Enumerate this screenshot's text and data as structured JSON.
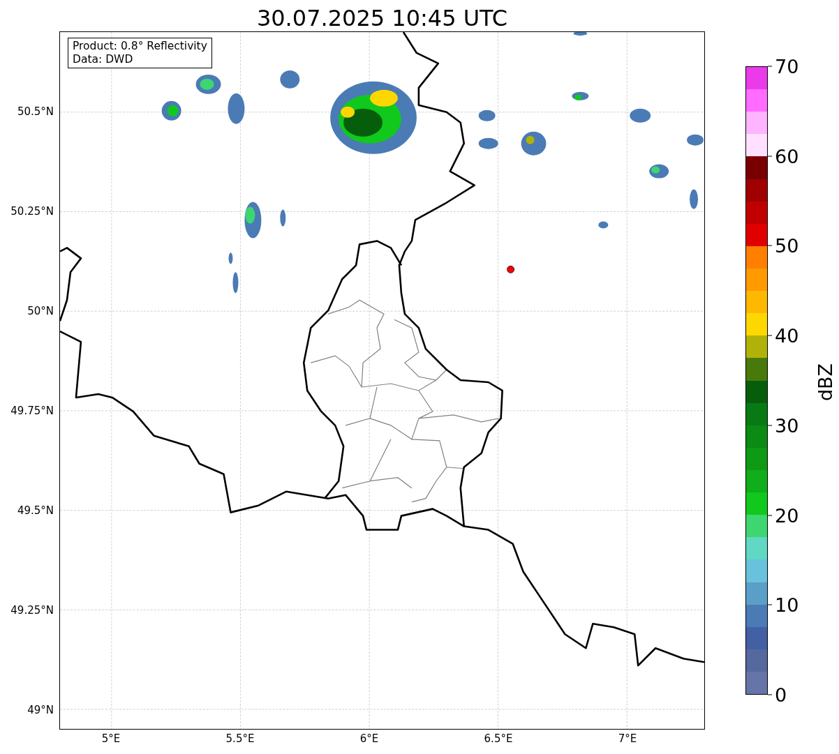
{
  "title": "30.07.2025 10:45 UTC",
  "info_box": {
    "lines": [
      "Product: 0.8° Reflectivity",
      "Data: DWD"
    ]
  },
  "map": {
    "xticks": [
      "5°E",
      "5.5°E",
      "6°E",
      "6.5°E",
      "7°E"
    ],
    "yticks": [
      "50.5°N",
      "50.25°N",
      "50°N",
      "49.75°N",
      "49.5°N",
      "49.25°N",
      "49°N"
    ]
  },
  "colorbar": {
    "label": "dBZ",
    "ticks": [
      "70",
      "60",
      "50",
      "40",
      "30",
      "20",
      "10",
      "0"
    ],
    "bands": [
      {
        "color": "#ea3aea"
      },
      {
        "color": "#ff6cff"
      },
      {
        "color": "#ffb4ff"
      },
      {
        "color": "#ffe0ff"
      },
      {
        "color": "#780000"
      },
      {
        "color": "#a00000"
      },
      {
        "color": "#c00000"
      },
      {
        "color": "#e00000"
      },
      {
        "color": "#ff7f00"
      },
      {
        "color": "#ff9a00"
      },
      {
        "color": "#ffb800"
      },
      {
        "color": "#ffd700"
      },
      {
        "color": "#b0b20a"
      },
      {
        "color": "#477a0a"
      },
      {
        "color": "#065e0c"
      },
      {
        "color": "#087a14"
      },
      {
        "color": "#0b8a14"
      },
      {
        "color": "#0e9a14"
      },
      {
        "color": "#10ae1a"
      },
      {
        "color": "#11c81c"
      },
      {
        "color": "#3dd670"
      },
      {
        "color": "#60d8c4"
      },
      {
        "color": "#68c2dc"
      },
      {
        "color": "#5a9fc8"
      },
      {
        "color": "#4a7bb5"
      },
      {
        "color": "#4360a5"
      },
      {
        "color": "#55699f"
      },
      {
        "color": "#6575a8"
      }
    ]
  }
}
